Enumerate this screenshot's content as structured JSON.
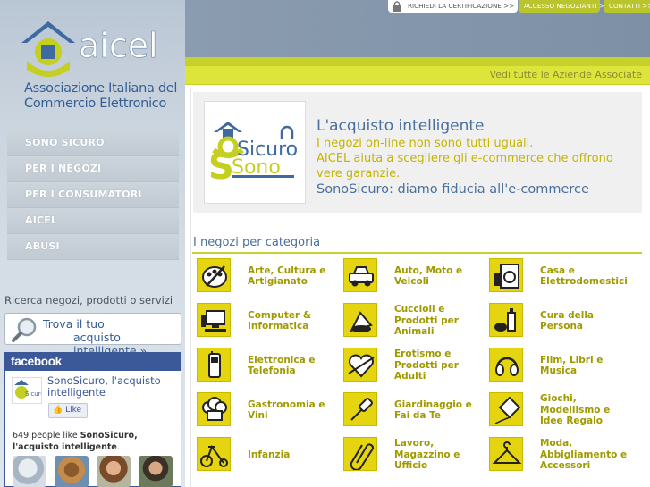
{
  "brand": {
    "logo_text": "aicel",
    "association_name": "Associazione Italiana del Commercio Elettronico"
  },
  "top_links": {
    "certification": "RICHIEDI LA CERTIFICAZIONE",
    "merchant_access": "ACCESSO NEGOZIANTI",
    "contacts": "CONTATTI"
  },
  "ticker": "Vedi tutte le Aziende Associate",
  "nav": [
    {
      "label": "SONO SICURO"
    },
    {
      "label": "PER I NEGOZI"
    },
    {
      "label": "PER I CONSUMATORI"
    },
    {
      "label": "AICEL"
    },
    {
      "label": "ABUSI"
    }
  ],
  "search": {
    "label": "Ricerca negozi, prodotti o servizi",
    "line1": "Trova il tuo",
    "line2": "acquisto intelligente »"
  },
  "facebook": {
    "header": "facebook",
    "page_name": "SonoSicuro, l'acquisto intelligente",
    "like_button": "Like",
    "like_count": "649",
    "likes_text": "people like",
    "likes_page": "SonoSicuro, l'acquisto intelligente",
    "avatar_text": "Sicuro"
  },
  "hero": {
    "logo_word_1": "Sicuro",
    "logo_word_2": "Sono",
    "title": "L'acquisto intelligente",
    "line1": "I negozi on-line non sono tutti uguali.",
    "line2": "AICEL aiuta a scegliere gli e-commerce che offrono",
    "line3": "vere garanzie.",
    "tagline": "SonoSicuro: diamo fiducia all'e-commerce"
  },
  "categories_title": "I negozi per categoria",
  "categories": [
    {
      "label": "Arte, Cultura e Artigianato",
      "icon": "palette-icon"
    },
    {
      "label": "Auto, Moto e Veicoli",
      "icon": "car-icon"
    },
    {
      "label": "Casa e Elettrodomestici",
      "icon": "appliance-icon"
    },
    {
      "label": "Computer & Informatica",
      "icon": "computer-icon"
    },
    {
      "label": "Cuccioli e Prodotti per Animali",
      "icon": "pet-food-icon"
    },
    {
      "label": "Cura della Persona",
      "icon": "cosmetics-icon"
    },
    {
      "label": "Elettronica e Telefonia",
      "icon": "phone-icon"
    },
    {
      "label": "Erotismo e Prodotti per Adulti",
      "icon": "heart-icon"
    },
    {
      "label": "Film, Libri e Musica",
      "icon": "headphones-icon"
    },
    {
      "label": "Gastronomia e Vini",
      "icon": "chef-hat-icon"
    },
    {
      "label": "Giardinaggio e Fai da Te",
      "icon": "screwdriver-icon"
    },
    {
      "label": "Giochi, Modellismo e Idee Regalo",
      "icon": "kite-icon"
    },
    {
      "label": "Infanzia",
      "icon": "tricycle-icon"
    },
    {
      "label": "Lavoro, Magazzino e Ufficio",
      "icon": "paperclip-icon"
    },
    {
      "label": "Moda, Abbigliamento e Accessori",
      "icon": "hanger-icon"
    }
  ]
}
